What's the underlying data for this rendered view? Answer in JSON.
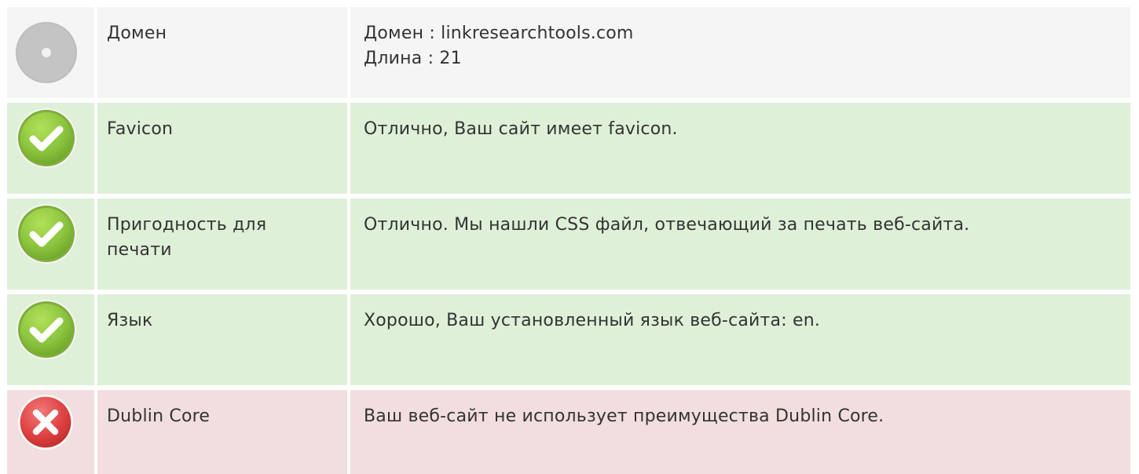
{
  "rows": [
    {
      "status": "neutral",
      "icon": "info-disc-icon",
      "label": "Домен",
      "value_lines": [
        "Домен : linkresearchtools.com",
        "Длина : 21"
      ]
    },
    {
      "status": "good",
      "icon": "check-icon",
      "label": "Favicon",
      "value_lines": [
        "Отлично, Ваш сайт имеет favicon."
      ]
    },
    {
      "status": "good",
      "icon": "check-icon",
      "label": "Пригодность для печати",
      "value_lines": [
        "Отлично. Мы нашли CSS файл, отвечающий за печать веб-сайта."
      ]
    },
    {
      "status": "good",
      "icon": "check-icon",
      "label": "Язык",
      "value_lines": [
        "Хорошо, Ваш установленный язык веб-сайта: en."
      ]
    },
    {
      "status": "bad",
      "icon": "cross-icon",
      "label": "Dublin Core",
      "value_lines": [
        "Ваш веб-сайт не использует преимущества Dublin Core."
      ]
    }
  ],
  "colors": {
    "neutral_bg": "#f5f5f5",
    "good_bg": "#dff0d8",
    "bad_bg": "#f2dede",
    "check_green": "#8cc63f",
    "cross_red": "#e04343",
    "neutral_grey": "#bdbdbd"
  }
}
